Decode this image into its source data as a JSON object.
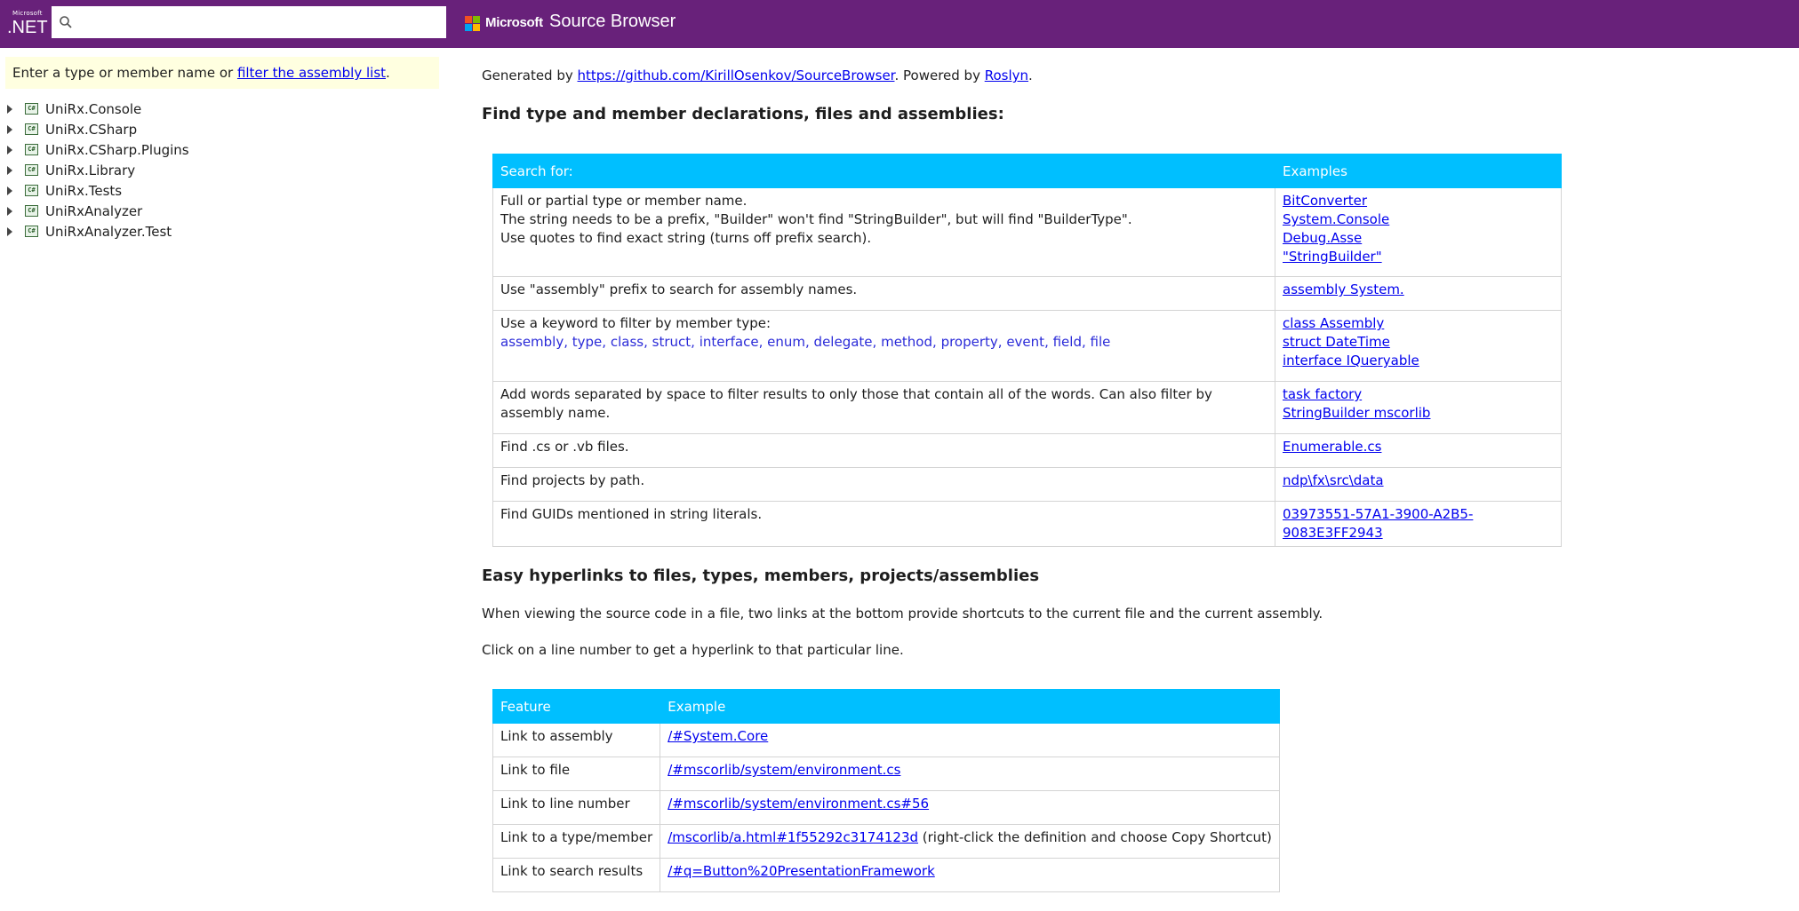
{
  "header": {
    "logo_small": "Microsoft",
    "logo_big": ".NET",
    "search_value": "",
    "search_placeholder": "",
    "ms_brand": "Microsoft",
    "title": "Source Browser",
    "colors": {
      "header_bg": "#68217a",
      "table_header": "#00bfff",
      "hint_bg": "#ffffe0"
    }
  },
  "left": {
    "hint_text": "Enter a type or member name or ",
    "hint_link": "filter the assembly list",
    "hint_end": ".",
    "tree": [
      {
        "label": "UniRx.Console",
        "icon": "csharp-project-icon"
      },
      {
        "label": "UniRx.CSharp",
        "icon": "csharp-project-icon"
      },
      {
        "label": "UniRx.CSharp.Plugins",
        "icon": "csharp-project-icon"
      },
      {
        "label": "UniRx.Library",
        "icon": "csharp-project-icon"
      },
      {
        "label": "UniRx.Tests",
        "icon": "csharp-project-icon"
      },
      {
        "label": "UniRxAnalyzer",
        "icon": "csharp-project-icon"
      },
      {
        "label": "UniRxAnalyzer.Test",
        "icon": "csharp-project-icon"
      }
    ]
  },
  "main": {
    "generated_prefix": "Generated by ",
    "generated_link": "https://github.com/KirillOsenkov/SourceBrowser",
    "powered_by": ". Powered by ",
    "roslyn_link": "Roslyn",
    "generated_end": ".",
    "title1": "Find type and member declarations, files and assemblies:",
    "search_table": {
      "headers": [
        "Search for:",
        "Examples"
      ],
      "rows": [
        {
          "desc": [
            "Full or partial type or member name.",
            "The string needs to be a prefix, \"Builder\" won't find \"StringBuilder\", but will find \"BuilderType\".",
            "Use quotes to find exact string (turns off prefix search)."
          ],
          "examples": [
            "BitConverter",
            "System.Console",
            "Debug.Asse",
            "\"StringBuilder\""
          ]
        },
        {
          "desc": [
            "Use \"assembly\" prefix to search for assembly names."
          ],
          "examples": [
            "assembly System."
          ]
        },
        {
          "desc": [
            "Use a keyword to filter by member type:"
          ],
          "keywords": [
            "assembly",
            "type",
            "class",
            "struct",
            "interface",
            "enum",
            "delegate",
            "method",
            "property",
            "event",
            "field",
            "file"
          ],
          "examples": [
            "class Assembly",
            "struct DateTime",
            "interface IQueryable"
          ]
        },
        {
          "desc": [
            "Add words separated by space to filter results to only those that contain all of the words. Can also filter by assembly name."
          ],
          "examples": [
            "task factory",
            "StringBuilder mscorlib"
          ]
        },
        {
          "desc": [
            "Find .cs or .vb files."
          ],
          "examples": [
            "Enumerable.cs"
          ]
        },
        {
          "desc": [
            "Find projects by path."
          ],
          "examples": [
            "ndp\\fx\\src\\data"
          ]
        },
        {
          "desc": [
            "Find GUIDs mentioned in string literals."
          ],
          "examples": [
            "03973551-57A1-3900-A2B5-9083E3FF2943"
          ]
        }
      ]
    },
    "title2": "Easy hyperlinks to files, types, members, projects/assemblies",
    "para1": "When viewing the source code in a file, two links at the bottom provide shortcuts to the current file and the current assembly.",
    "para2": "Click on a line number to get a hyperlink to that particular line.",
    "feature_table": {
      "headers": [
        "Feature",
        "Example"
      ],
      "rows": [
        {
          "feature": "Link to assembly",
          "link": "/#System.Core",
          "note": ""
        },
        {
          "feature": "Link to file",
          "link": "/#mscorlib/system/environment.cs",
          "note": ""
        },
        {
          "feature": "Link to line number",
          "link": "/#mscorlib/system/environment.cs#56",
          "note": ""
        },
        {
          "feature": "Link to a type/member",
          "link": "/mscorlib/a.html#1f55292c3174123d",
          "note": " (right-click the definition and choose Copy Shortcut)"
        },
        {
          "feature": "Link to search results",
          "link": "/#q=Button%20PresentationFramework",
          "note": ""
        }
      ]
    }
  }
}
